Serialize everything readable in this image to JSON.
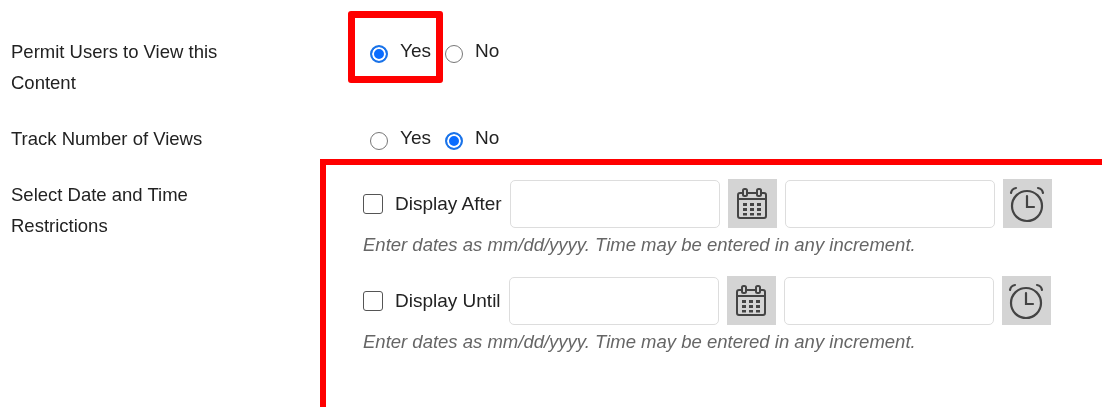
{
  "fields": [
    {
      "kind": "radio",
      "label": "Permit Users to View this Content",
      "options": [
        {
          "label": "Yes",
          "selected": true,
          "highlighted": true
        },
        {
          "label": "No",
          "selected": false,
          "highlighted": false
        }
      ]
    },
    {
      "kind": "radio",
      "label": "Track Number of Views",
      "options": [
        {
          "label": "Yes",
          "selected": false,
          "highlighted": false
        },
        {
          "label": "No",
          "selected": true,
          "highlighted": false
        }
      ]
    },
    {
      "kind": "restrictions",
      "label": "Select Date and Time Restrictions",
      "highlighted": true,
      "restrictions": [
        {
          "label": "Display After",
          "checked": false,
          "hint": "Enter dates as mm/dd/yyyy. Time may be entered in any increment."
        },
        {
          "label": "Display Until",
          "checked": false,
          "hint": "Enter dates as mm/dd/yyyy. Time may be entered in any increment."
        }
      ]
    }
  ]
}
